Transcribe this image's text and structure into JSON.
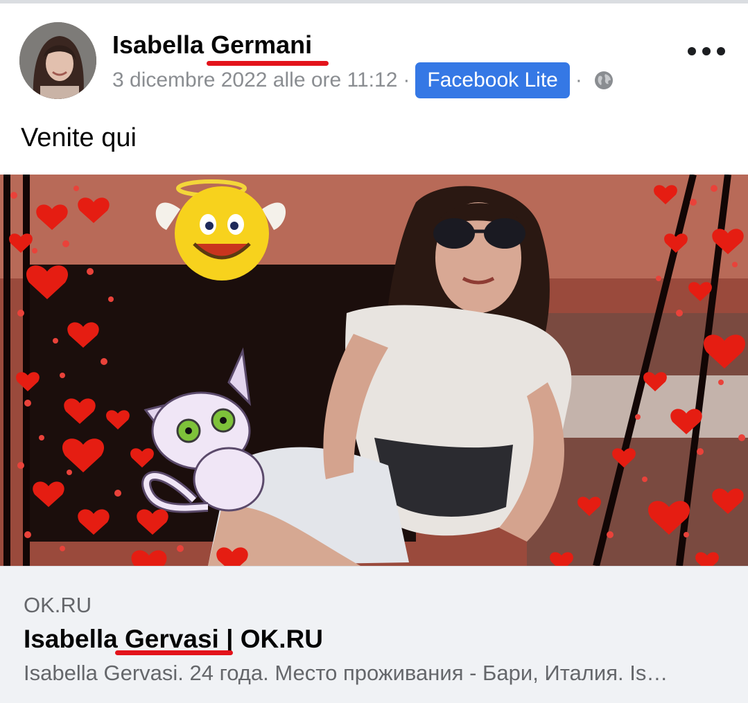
{
  "post": {
    "author": "Isabella Germani",
    "date": "3 dicembre 2022 alle ore 11:12",
    "separator": "·",
    "app_badge": "Facebook Lite",
    "privacy_icon": "globe-icon",
    "more_icon": "more-horizontal-icon",
    "text": "Venite qui"
  },
  "link_preview": {
    "domain": "OK.RU",
    "title": "Isabella Gervasi | OK.RU",
    "description": "Isabella Gervasi. 24 года. Место проживания - Бари, Италия. Is…"
  },
  "colors": {
    "badge_blue": "#3578e5",
    "annotation_red": "#e3131b",
    "card_bg": "#f0f2f5",
    "meta_gray": "#8a8d91"
  }
}
